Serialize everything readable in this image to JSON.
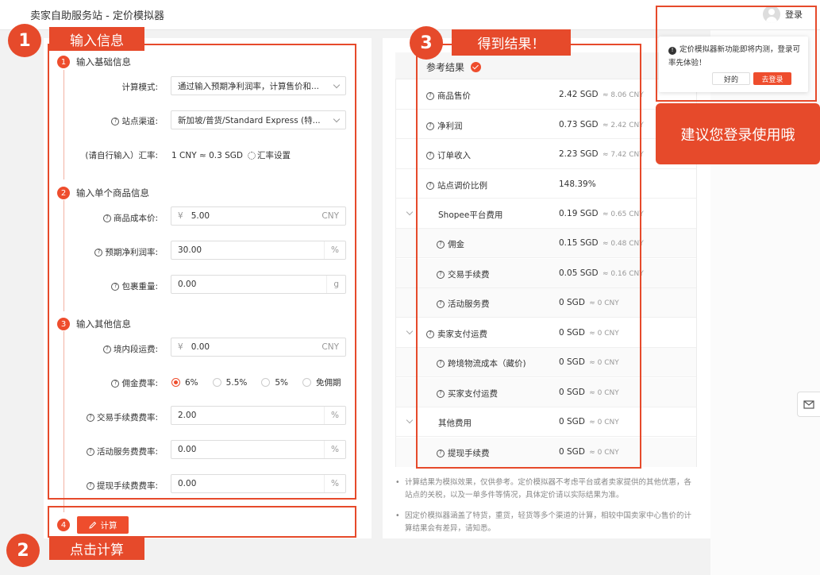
{
  "header": {
    "title": "卖家自助服务站 - 定价模拟器",
    "login_label": "登录"
  },
  "popover": {
    "message": "定价模拟器新功能即将内测，登录可率先体验！",
    "ok_label": "好的",
    "login_label": "去登录"
  },
  "sections": {
    "basic": {
      "step": "1",
      "title": "输入基础信息"
    },
    "product": {
      "step": "2",
      "title": "输入单个商品信息"
    },
    "other": {
      "step": "3",
      "title": "输入其他信息"
    },
    "calc": {
      "step": "4"
    }
  },
  "form": {
    "calc_mode": {
      "label": "计算模式:",
      "value": "通过输入预期净利润率，计算售价和..."
    },
    "channel": {
      "label": "站点渠道:",
      "value": "新加坡/普货/Standard Express (特..."
    },
    "exchange": {
      "label": "(请自行输入）汇率:",
      "value": "1 CNY ≈ 0.3 SGD",
      "settings_label": "汇率设置"
    },
    "cost": {
      "label": "商品成本价:",
      "prefix": "¥",
      "value": "5.00",
      "suffix": "CNY"
    },
    "profit_rate": {
      "label": "预期净利润率:",
      "value": "30.00",
      "suffix": "%"
    },
    "weight": {
      "label": "包裹重量:",
      "value": "0.00",
      "suffix": "g"
    },
    "domestic_fee": {
      "label": "境内段运费:",
      "prefix": "¥",
      "value": "0.00",
      "suffix": "CNY"
    },
    "commission": {
      "label": "佣金费率:",
      "options": [
        "6%",
        "5.5%",
        "5%",
        "免佣期"
      ],
      "selected": "6%"
    },
    "transaction_rate": {
      "label": "交易手续费费率:",
      "value": "2.00",
      "suffix": "%"
    },
    "service_rate": {
      "label": "活动服务费费率:",
      "value": "0.00",
      "suffix": "%"
    },
    "withdraw_rate": {
      "label": "提现手续费费率:",
      "value": "0.00",
      "suffix": "%"
    },
    "calc_button": "计算"
  },
  "result": {
    "title": "参考结果",
    "rows": [
      {
        "label": "商品售价",
        "sgd": "2.42 SGD",
        "cny": "≈ 8.06 CNY"
      },
      {
        "label": "净利润",
        "sgd": "0.73 SGD",
        "cny": "≈ 2.42 CNY"
      },
      {
        "label": "订单收入",
        "sgd": "2.23 SGD",
        "cny": "≈ 7.42 CNY"
      },
      {
        "label": "站点调价比例",
        "sgd": "148.39%",
        "cny": ""
      },
      {
        "label": "Shopee平台费用",
        "sgd": "0.19 SGD",
        "cny": "≈ 0.65 CNY"
      },
      {
        "label": "佣金",
        "sgd": "0.15 SGD",
        "cny": "≈ 0.48 CNY"
      },
      {
        "label": "交易手续费",
        "sgd": "0.05 SGD",
        "cny": "≈ 0.16 CNY"
      },
      {
        "label": "活动服务费",
        "sgd": "0 SGD",
        "cny": "≈ 0 CNY"
      },
      {
        "label": "卖家支付运费",
        "sgd": "0 SGD",
        "cny": "≈ 0 CNY"
      },
      {
        "label": "跨境物流成本（藏价)",
        "sgd": "0 SGD",
        "cny": "≈ 0 CNY"
      },
      {
        "label": "买家支付运费",
        "sgd": "0 SGD",
        "cny": "≈ 0 CNY"
      },
      {
        "label": "其他费用",
        "sgd": "0 SGD",
        "cny": "≈ 0 CNY"
      },
      {
        "label": "提现手续费",
        "sgd": "0 SGD",
        "cny": "≈ 0 CNY"
      }
    ],
    "notes": [
      "计算结果为模拟效果，仅供参考。定价模拟器不考虑平台或者卖家提供的其他优惠，各站点的关税，以及一单多件等情况，具体定价请以实际结果为准。",
      "因定价模拟器涵盖了特货，重货，轻货等多个渠道的计算，相较中国卖家中心售价的计算结果会有差异，请知悉。"
    ]
  },
  "annotations": {
    "step1": {
      "number": "1",
      "label": "输入信息"
    },
    "step2": {
      "number": "2",
      "label": "点击计算"
    },
    "step3": {
      "number": "3",
      "label": "得到结果！"
    },
    "tip": "建议您登录使用哦"
  },
  "colors": {
    "accent": "#ee4d2d",
    "annotation": "#e64a2b"
  }
}
